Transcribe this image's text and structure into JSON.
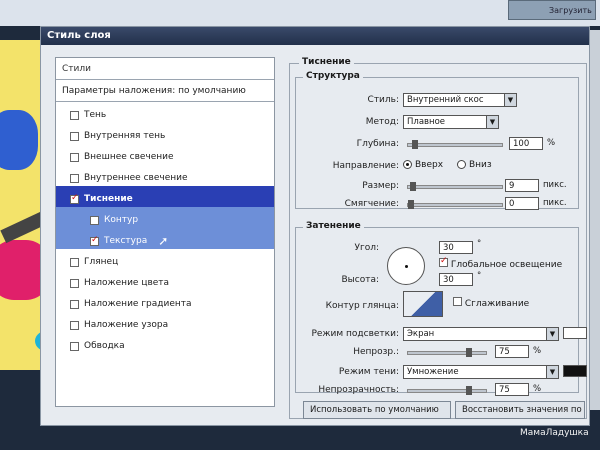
{
  "topbar": {
    "button_label": "Загрузить"
  },
  "dialog": {
    "title": "Стиль слоя",
    "left": {
      "styles_header": "Стили",
      "blend_header": "Параметры наложения: по умолчанию",
      "items": [
        {
          "label": "Тень",
          "checked": false
        },
        {
          "label": "Внутренняя тень",
          "checked": false
        },
        {
          "label": "Внешнее свечение",
          "checked": false
        },
        {
          "label": "Внутреннее свечение",
          "checked": false
        },
        {
          "label": "Тиснение",
          "checked": true
        },
        {
          "label": "Контур",
          "checked": false
        },
        {
          "label": "Текстура",
          "checked": true
        },
        {
          "label": "Глянец",
          "checked": false
        },
        {
          "label": "Наложение цвета",
          "checked": false
        },
        {
          "label": "Наложение градиента",
          "checked": false
        },
        {
          "label": "Наложение узора",
          "checked": false
        },
        {
          "label": "Обводка",
          "checked": false
        }
      ]
    },
    "right": {
      "section_title": "Тиснение",
      "structure": {
        "legend": "Структура",
        "style_label": "Стиль:",
        "style_value": "Внутренний скос",
        "method_label": "Метод:",
        "method_value": "Плавное",
        "depth_label": "Глубина:",
        "depth_value": "100",
        "depth_unit": "%",
        "direction_label": "Направление:",
        "dir_up": "Вверх",
        "dir_down": "Вниз",
        "size_label": "Размер:",
        "size_value": "9",
        "size_unit": "пикс.",
        "soften_label": "Смягчение:",
        "soften_value": "0",
        "soften_unit": "пикс."
      },
      "shading": {
        "legend": "Затенение",
        "angle_label": "Угол:",
        "angle_value": "30",
        "deg": "°",
        "global_light_label": "Глобальное освещение",
        "altitude_label": "Высота:",
        "altitude_value": "30",
        "gloss_label": "Контур глянца:",
        "antialias_label": "Сглаживание",
        "highlight_label": "Режим подсветки:",
        "highlight_value": "Экран",
        "opacity1_label": "Непрозр.:",
        "opacity1_value": "75",
        "pct": "%",
        "shadow_label": "Режим тени:",
        "shadow_value": "Умножение",
        "opacity2_label": "Непрозрачность:",
        "opacity2_value": "75"
      },
      "btn_default": "Использовать по умолчанию",
      "btn_restore": "Восстановить значения по умо"
    }
  },
  "watermark": "МамаЛадушка",
  "colors": {
    "highlight": "#ffffff",
    "shadow": "#111111",
    "selection": "#2a3fb4"
  }
}
